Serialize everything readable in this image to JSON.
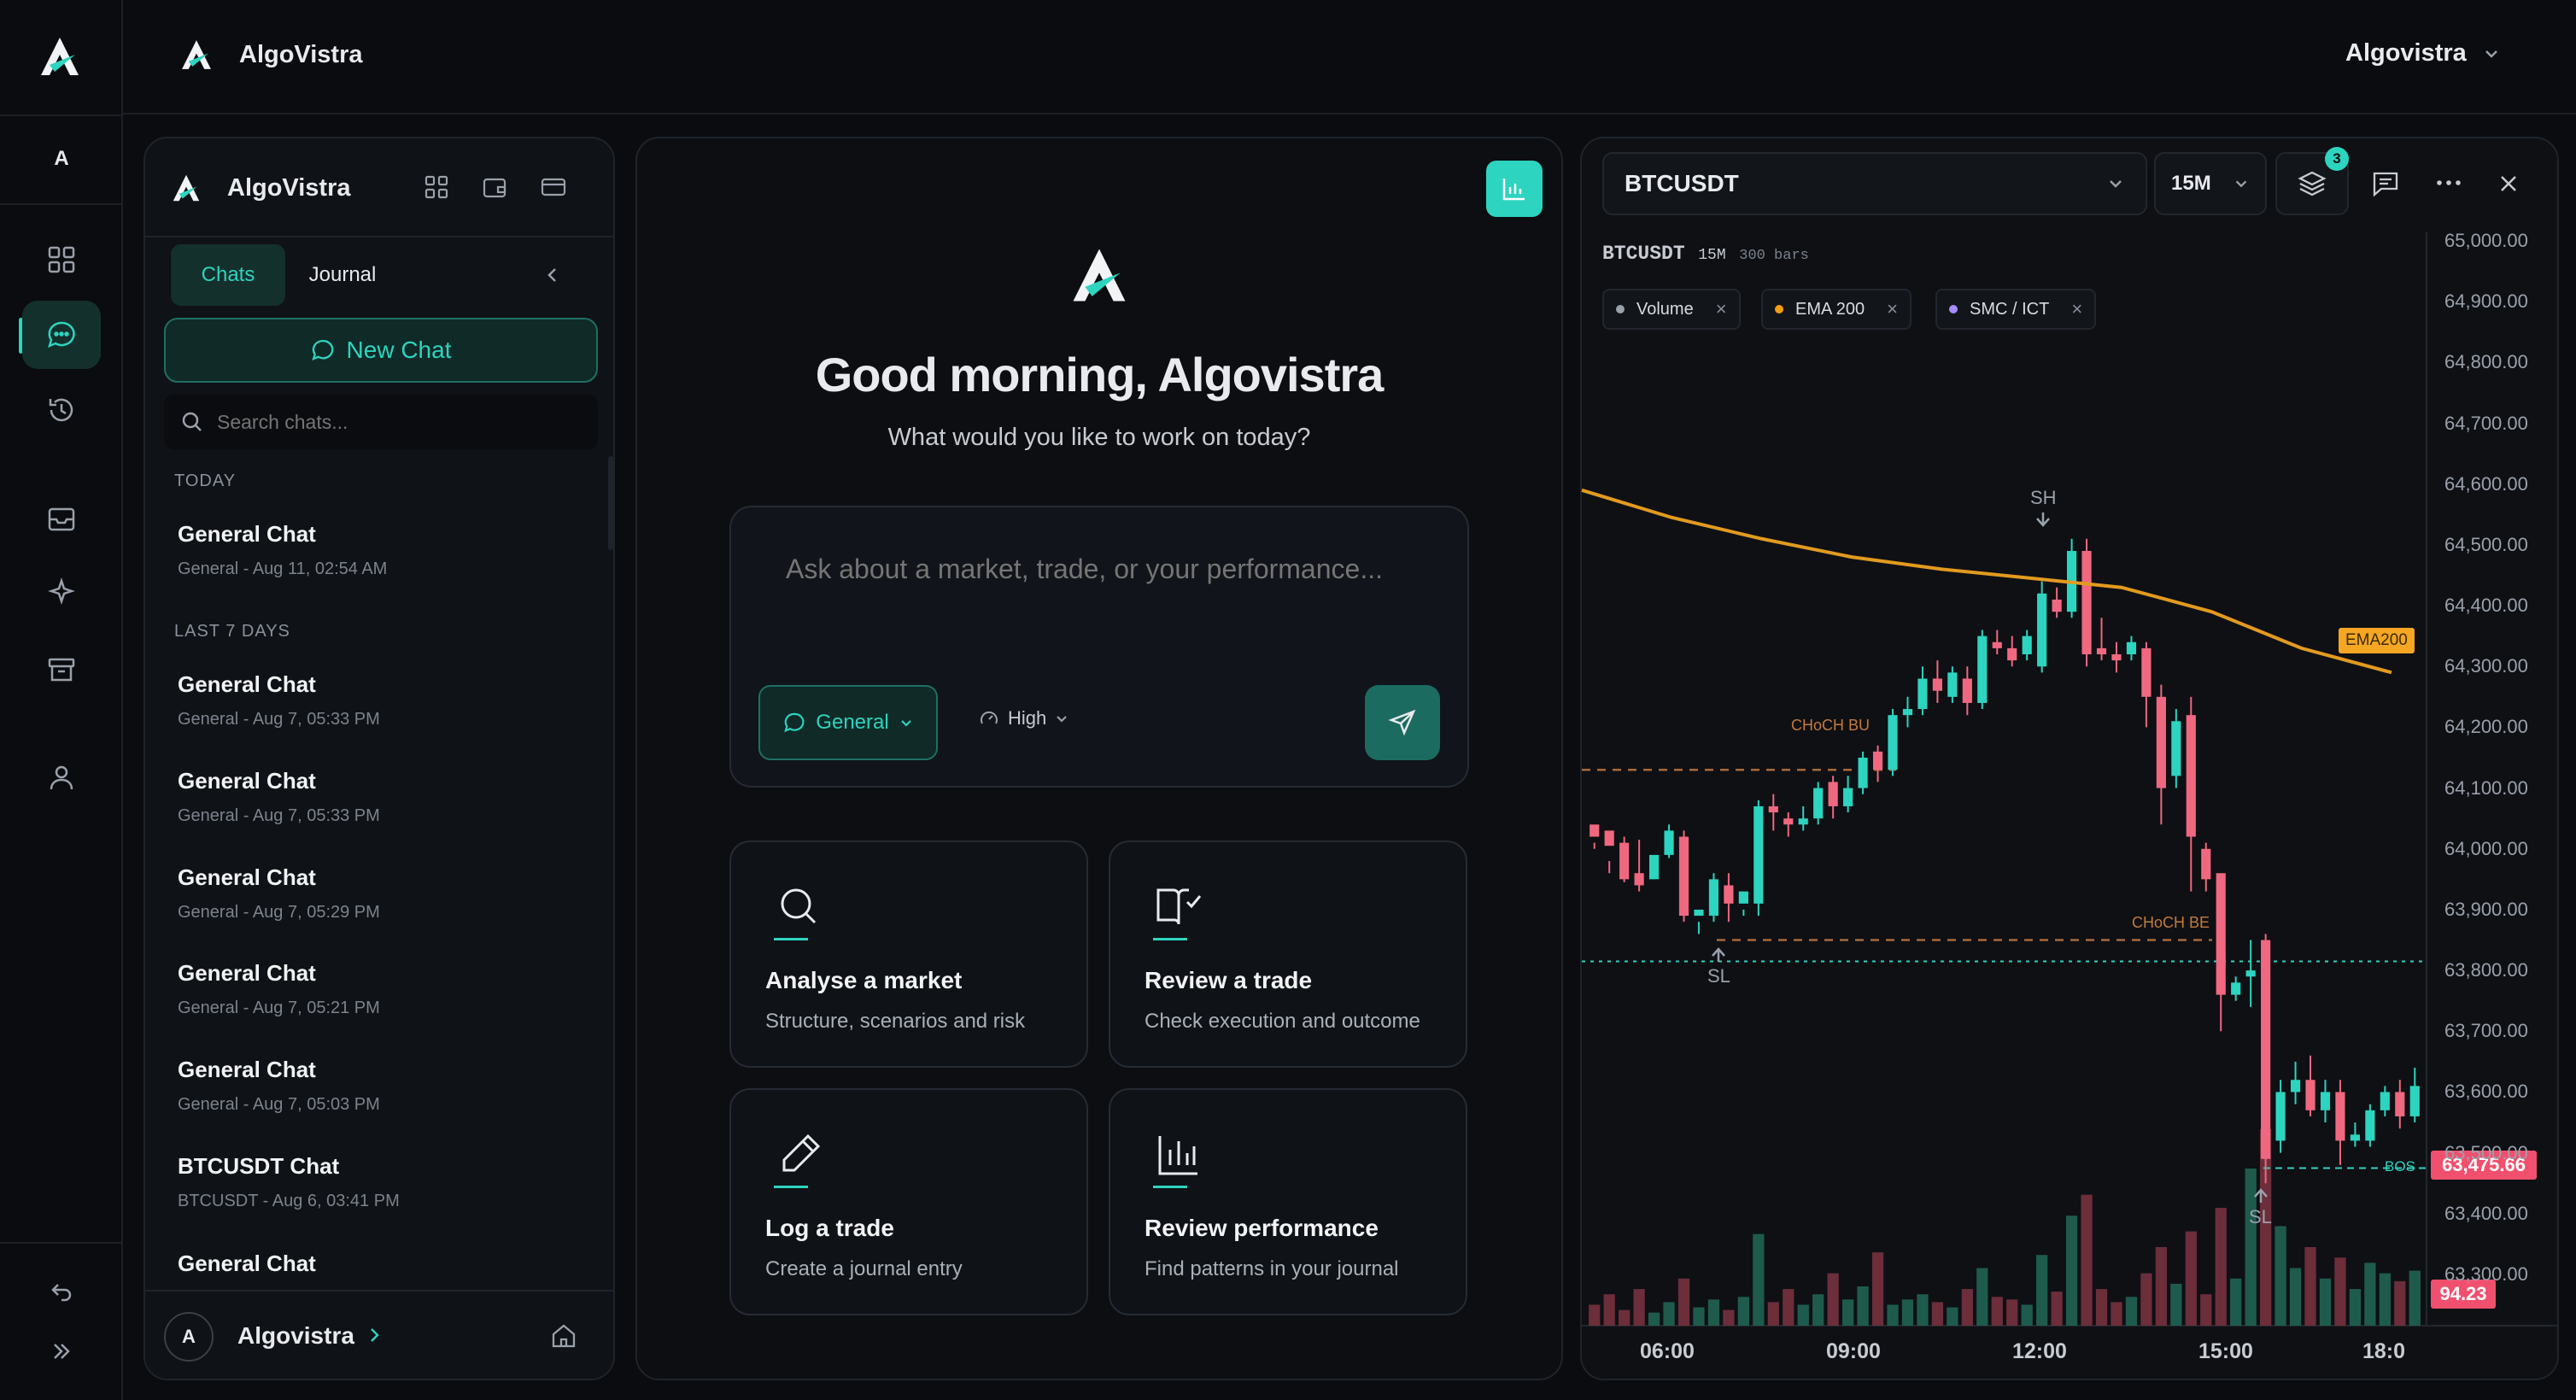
{
  "app": {
    "name": "AlgoVistra"
  },
  "rail": {
    "avatar_letter": "A"
  },
  "topbar": {
    "title": "AlgoVistra",
    "user_label": "Algovistra"
  },
  "sidebar": {
    "brand": "AlgoVistra",
    "tabs": [
      {
        "label": "Chats"
      },
      {
        "label": "Journal"
      }
    ],
    "new_chat_label": "New Chat",
    "search_placeholder": "Search chats...",
    "sections": [
      {
        "label": "TODAY",
        "items": [
          {
            "title": "General Chat",
            "subtitle": "General - Aug 11, 02:54 AM"
          }
        ]
      },
      {
        "label": "LAST 7 DAYS",
        "items": [
          {
            "title": "General Chat",
            "subtitle": "General - Aug 7, 05:33 PM"
          },
          {
            "title": "General Chat",
            "subtitle": "General - Aug 7, 05:33 PM"
          },
          {
            "title": "General Chat",
            "subtitle": "General - Aug 7, 05:29 PM"
          },
          {
            "title": "General Chat",
            "subtitle": "General - Aug 7, 05:21 PM"
          },
          {
            "title": "General Chat",
            "subtitle": "General - Aug 7, 05:03 PM"
          },
          {
            "title": "BTCUSDT Chat",
            "subtitle": "BTCUSDT - Aug 6, 03:41 PM"
          },
          {
            "title": "General Chat",
            "subtitle": ""
          }
        ]
      }
    ],
    "user": {
      "avatar_letter": "A",
      "name": "Algovistra"
    }
  },
  "main": {
    "greeting": "Good morning, Algovistra",
    "subheading": "What would you like to work on today?",
    "prompt_placeholder": "Ask about a market, trade, or your performance...",
    "mode_select": "General",
    "effort_select": "High",
    "cards": [
      {
        "icon": "search-icon",
        "title": "Analyse a market",
        "subtitle": "Structure, scenarios and risk"
      },
      {
        "icon": "book-check-icon",
        "title": "Review a trade",
        "subtitle": "Check execution and outcome"
      },
      {
        "icon": "pen-icon",
        "title": "Log a trade",
        "subtitle": "Create a journal entry"
      },
      {
        "icon": "bar-chart-icon",
        "title": "Review performance",
        "subtitle": "Find patterns in your journal"
      }
    ]
  },
  "chart": {
    "symbol": "BTCUSDT",
    "timeframe": "15M",
    "layers_badge": "3",
    "info_symbol": "BTCUSDT",
    "info_tf": "15M",
    "info_bars": "300 bars",
    "indicators": [
      {
        "name": "Volume",
        "color": "#9aa1ab"
      },
      {
        "name": "EMA 200",
        "color": "#f59e0b"
      },
      {
        "name": "SMC / ICT",
        "color": "#a78bfa"
      }
    ],
    "y_axis_labels": [
      "65,000.00",
      "64,900.00",
      "64,800.00",
      "64,700.00",
      "64,600.00",
      "64,500.00",
      "64,400.00",
      "64,300.00",
      "64,200.00",
      "64,100.00",
      "64,000.00",
      "63,900.00",
      "63,800.00",
      "63,700.00",
      "63,600.00",
      "63,500.00",
      "63,400.00",
      "63,300.00"
    ],
    "x_axis_labels": [
      "06:00",
      "09:00",
      "12:00",
      "15:00",
      "18:0"
    ],
    "last_price": "63,475.66",
    "last_volume": "94.23",
    "ema_tag": "EMA200",
    "annotations": {
      "sh": "SH",
      "sl1": "SL",
      "sl2": "SL",
      "choch_bull": "CHoCH BU",
      "choch_bear": "CHoCH BE",
      "bos": "BOS"
    }
  },
  "chart_data": {
    "type": "candlestick",
    "symbol": "BTCUSDT",
    "timeframe": "15M",
    "ylim": [
      63250,
      65050
    ],
    "price_levels": {
      "swing_high": 64510,
      "choch_bull": 64130,
      "choch_bear": 63850,
      "swing_low_line": 63815,
      "bos": 63475
    },
    "ema200": [
      [
        0,
        64590
      ],
      [
        10,
        64545
      ],
      [
        20,
        64510
      ],
      [
        30,
        64480
      ],
      [
        40,
        64460
      ],
      [
        50,
        64445
      ],
      [
        60,
        64430
      ],
      [
        70,
        64390
      ],
      [
        80,
        64330
      ],
      [
        90,
        64290
      ]
    ],
    "candles": [
      [
        64040,
        64020,
        64010,
        64000
      ],
      [
        64030,
        64005,
        63980,
        63960
      ],
      [
        64010,
        63950,
        64020,
        63945
      ],
      [
        63960,
        63940,
        64015,
        63930
      ],
      [
        63950,
        63990,
        63970,
        63950
      ],
      [
        63990,
        64030,
        64040,
        63985
      ],
      [
        64020,
        63890,
        64030,
        63880
      ],
      [
        63890,
        63900,
        63880,
        63860
      ],
      [
        63890,
        63950,
        63960,
        63880
      ],
      [
        63940,
        63910,
        63960,
        63880
      ],
      [
        63910,
        63930,
        63900,
        63890
      ],
      [
        63910,
        64070,
        64080,
        63890
      ],
      [
        64070,
        64060,
        64090,
        64030
      ],
      [
        64050,
        64040,
        64060,
        64020
      ],
      [
        64040,
        64050,
        64070,
        64030
      ],
      [
        64050,
        64100,
        64110,
        64040
      ],
      [
        64110,
        64070,
        64120,
        64050
      ],
      [
        64070,
        64100,
        64120,
        64060
      ],
      [
        64100,
        64150,
        64160,
        64090
      ],
      [
        64160,
        64130,
        64170,
        64110
      ],
      [
        64130,
        64220,
        64230,
        64120
      ],
      [
        64220,
        64230,
        64250,
        64200
      ],
      [
        64230,
        64280,
        64300,
        64220
      ],
      [
        64280,
        64260,
        64310,
        64240
      ],
      [
        64250,
        64290,
        64300,
        64240
      ],
      [
        64280,
        64240,
        64300,
        64220
      ],
      [
        64240,
        64350,
        64360,
        64230
      ],
      [
        64340,
        64330,
        64360,
        64320
      ],
      [
        64330,
        64310,
        64350,
        64300
      ],
      [
        64320,
        64350,
        64360,
        64310
      ],
      [
        64300,
        64420,
        64440,
        64290
      ],
      [
        64410,
        64390,
        64430,
        64380
      ],
      [
        64390,
        64490,
        64510,
        64380
      ],
      [
        64490,
        64320,
        64510,
        64300
      ],
      [
        64330,
        64320,
        64380,
        64310
      ],
      [
        64320,
        64310,
        64340,
        64290
      ],
      [
        64320,
        64340,
        64350,
        64310
      ],
      [
        64330,
        64250,
        64340,
        64200
      ],
      [
        64250,
        64100,
        64270,
        64040
      ],
      [
        64120,
        64210,
        64230,
        64100
      ],
      [
        64220,
        64020,
        64250,
        63930
      ],
      [
        64000,
        63950,
        64010,
        63930
      ],
      [
        63960,
        63760,
        63960,
        63700
      ],
      [
        63760,
        63780,
        63790,
        63750
      ],
      [
        63790,
        63800,
        63850,
        63740
      ],
      [
        63850,
        63490,
        63860,
        63450
      ],
      [
        63520,
        63600,
        63620,
        63500
      ],
      [
        63600,
        63620,
        63650,
        63580
      ],
      [
        63620,
        63570,
        63660,
        63560
      ],
      [
        63570,
        63600,
        63620,
        63550
      ],
      [
        63600,
        63520,
        63620,
        63480
      ],
      [
        63520,
        63530,
        63550,
        63510
      ],
      [
        63520,
        63570,
        63580,
        63510
      ],
      [
        63570,
        63600,
        63610,
        63560
      ],
      [
        63600,
        63560,
        63620,
        63540
      ],
      [
        63560,
        63610,
        63640,
        63550
      ]
    ],
    "volume": [
      8,
      12,
      6,
      14,
      5,
      9,
      18,
      7,
      10,
      6,
      11,
      35,
      9,
      14,
      8,
      12,
      20,
      10,
      15,
      28,
      8,
      10,
      12,
      9,
      7,
      14,
      22,
      11,
      10,
      8,
      27,
      13,
      42,
      50,
      14,
      9,
      11,
      20,
      30,
      16,
      36,
      12,
      45,
      18,
      60,
      75,
      38,
      22,
      30,
      18,
      26,
      14,
      24,
      20,
      17,
      21
    ]
  }
}
